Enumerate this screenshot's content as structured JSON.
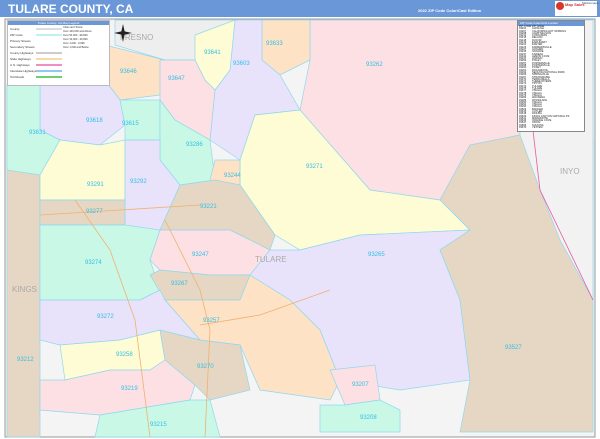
{
  "header": {
    "title": "TULARE COUNTY, CA",
    "edition": "2022 ZIP Code Color/Cast Edition",
    "logo_text": "Map Sales",
    "logo_subtext": "Marketmaps"
  },
  "legend": {
    "title": "Tulare County, CA Map Legend",
    "items": [
      "County",
      "ZIP Code",
      "Primary Streets",
      "Secondary Streets",
      "County Highways",
      "State Highways",
      "U.S. Highways",
      "Interstate Highways",
      "Toll Roads"
    ],
    "population_title": "Cities and Towns",
    "population": [
      "Over 100,000 and Above",
      "Over 50,000 - 99,999",
      "Over 10,000 - 49,999",
      "Over 1,000 - 9,999",
      "Over 1,000 and Below"
    ]
  },
  "index": {
    "title": "ZIP Code Index/Grid Locator",
    "headers": [
      "ZIP CODE",
      "ZIP NAME"
    ],
    "rows": [
      [
        "93201",
        "ALPAUGH"
      ],
      [
        "93207",
        "CALIFORNIA HOT SPRINGS"
      ],
      [
        "93208",
        "CAMP NELSON"
      ],
      [
        "93212",
        "CORCORAN"
      ],
      [
        "93215",
        "DELANO"
      ],
      [
        "93218",
        "DUCOR"
      ],
      [
        "93219",
        "EARLIMART"
      ],
      [
        "93221",
        "EXETER"
      ],
      [
        "93223",
        "FARMERSVILLE"
      ],
      [
        "93227",
        "GOSHEN"
      ],
      [
        "93235",
        "IVANHOE"
      ],
      [
        "93237",
        "KAWEAH"
      ],
      [
        "93244",
        "LEMON COVE"
      ],
      [
        "93247",
        "LINDSAY"
      ],
      [
        "93256",
        "PIXLEY"
      ],
      [
        "93257",
        "PORTERVILLE"
      ],
      [
        "93258",
        "PORTERVILLE"
      ],
      [
        "93260",
        "POSEY"
      ],
      [
        "93261",
        "RICHGROVE"
      ],
      [
        "93262",
        "SEQUOIA NATIONAL PARK"
      ],
      [
        "93265",
        "SPRINGVILLE"
      ],
      [
        "93267",
        "STRATHMORE"
      ],
      [
        "93270",
        "TERRA BELLA"
      ],
      [
        "93271",
        "THREE RIVERS"
      ],
      [
        "93272",
        "TIPTON"
      ],
      [
        "93274",
        "TULARE"
      ],
      [
        "93275",
        "TULARE"
      ],
      [
        "93277",
        "VISALIA"
      ],
      [
        "93278",
        "VISALIA"
      ],
      [
        "93279",
        "VISALIA"
      ],
      [
        "93282",
        "WAUKENA"
      ],
      [
        "93286",
        "WOODLAKE"
      ],
      [
        "93290",
        "VISALIA"
      ],
      [
        "93291",
        "VISALIA"
      ],
      [
        "93292",
        "VISALIA"
      ],
      [
        "93603",
        "BADGER"
      ],
      [
        "93615",
        "CUTLER"
      ],
      [
        "93618",
        "DINUBA"
      ],
      [
        "93633",
        "KINGS CANYON NATIONAL PK"
      ],
      [
        "93641",
        "MIRAMONTE"
      ],
      [
        "93646",
        "ORANGE COVE"
      ],
      [
        "93647",
        "OROSI"
      ],
      [
        "93666",
        "SULTANA"
      ],
      [
        "93670",
        "YETTEM"
      ]
    ]
  },
  "map": {
    "counties": {
      "fresno": "FRESNO",
      "tulare": "TULARE",
      "inyo": "INYO",
      "kings": "KINGS"
    },
    "zips": {
      "z93633": "93633",
      "z93641": "93641",
      "z93603": "93603",
      "z93262": "93262",
      "z93646": "93646",
      "z93647": "93647",
      "z93631": "93631",
      "z93618": "93618",
      "z93615": "93615",
      "z93286": "93286",
      "z93244": "93244",
      "z93271": "93271",
      "z93291": "93291",
      "z93292": "93292",
      "z93277": "93277",
      "z93221": "93221",
      "z93274": "93274",
      "z93247": "93247",
      "z93265": "93265",
      "z93267": "93267",
      "z93257": "93257",
      "z93272": "93272",
      "z93212": "93212",
      "z93258": "93258",
      "z93270": "93270",
      "z93219": "93219",
      "z93215": "93215",
      "z93207": "93207",
      "z93208": "93208",
      "z93527": "93527"
    },
    "colors": {
      "pink": "#fde0e3",
      "purple": "#e8e3fb",
      "yellow": "#fefcd4",
      "mint": "#c9f9e6",
      "tan": "#e6d7c4",
      "peach": "#fde2c6",
      "gray": "#f0f0f0",
      "border": "#8fd8ee"
    }
  }
}
